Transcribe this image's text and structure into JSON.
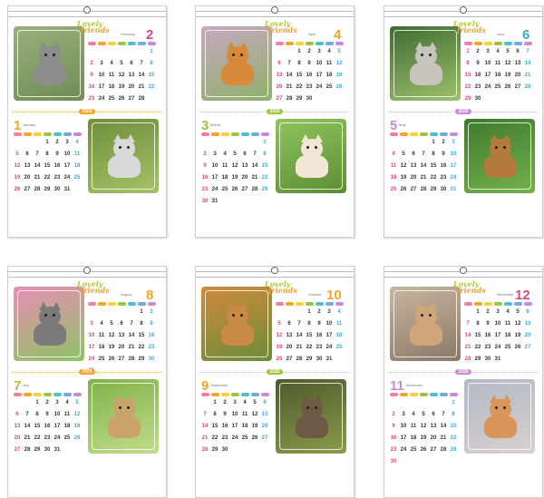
{
  "brand": {
    "line1": "Lovely",
    "line2": "friends"
  },
  "year_label": "2025",
  "colors": {
    "sunday": "#e0457b",
    "saturday": "#3aa9de",
    "weekday": "#333333",
    "year_pill_1": "#f6a623",
    "year_pill_2": "#9fc63b",
    "year_pill_3": "#c98ad6",
    "dow_pills": [
      "#f47fa5",
      "#f6a623",
      "#f7d239",
      "#9fc63b",
      "#4cc3c9",
      "#74a8e6",
      "#c98ad6"
    ]
  },
  "pages": [
    {
      "name": "page-jan-feb",
      "top": {
        "num": "2",
        "label": "February",
        "num_color": "#e0457b",
        "start": 6,
        "days": 28,
        "photo": "gray-tabby-kitten",
        "bg": [
          "#9bb07a",
          "#6f8c55"
        ]
      },
      "bottom": {
        "num": "1",
        "label": "January",
        "num_color": "#f6a623",
        "start": 3,
        "days": 31,
        "photo": "french-bulldog",
        "bg": [
          "#6e8e3c",
          "#a7c267"
        ]
      }
    },
    {
      "name": "page-mar-apr",
      "top": {
        "num": "4",
        "label": "April",
        "num_color": "#f6a623",
        "start": 2,
        "days": 30,
        "photo": "white-gray-kitten",
        "bg": [
          "#c7a8c0",
          "#8fb06a"
        ]
      },
      "bottom": {
        "num": "3",
        "label": "March",
        "num_color": "#9fc63b",
        "start": 6,
        "days": 31,
        "photo": "brown-toy-poodle",
        "bg": [
          "#8fc45d",
          "#5d8d34"
        ]
      }
    },
    {
      "name": "page-may-jun",
      "top": {
        "num": "6",
        "label": "June",
        "num_color": "#3aa9de",
        "start": 0,
        "days": 30,
        "photo": "orange-kitten",
        "bg": [
          "#3f6c33",
          "#9fc06c"
        ]
      },
      "bottom": {
        "num": "5",
        "label": "May",
        "num_color": "#c98ad6",
        "start": 4,
        "days": 31,
        "photo": "two-puppies",
        "bg": [
          "#3e7a2e",
          "#76b04c"
        ]
      }
    },
    {
      "name": "page-jul-aug",
      "top": {
        "num": "8",
        "label": "August",
        "num_color": "#f6a623",
        "start": 5,
        "days": 31,
        "photo": "two-kittens-flowers",
        "bg": [
          "#e88db4",
          "#8cc464"
        ]
      },
      "bottom": {
        "num": "7",
        "label": "July",
        "num_color": "#9fc63b",
        "start": 2,
        "days": 31,
        "photo": "chihuahua-puppy",
        "bg": [
          "#7fb24a",
          "#c3dc8b"
        ]
      }
    },
    {
      "name": "page-sep-oct",
      "top": {
        "num": "10",
        "label": "October",
        "num_color": "#f6a623",
        "start": 3,
        "days": 31,
        "photo": "gray-cat-grass",
        "bg": [
          "#d18a3c",
          "#6b8c3a"
        ]
      },
      "bottom": {
        "num": "9",
        "label": "September",
        "num_color": "#f6a623",
        "start": 1,
        "days": 30,
        "photo": "two-shiba-puppies",
        "bg": [
          "#4c5a2c",
          "#8b9c4a"
        ]
      }
    },
    {
      "name": "page-nov-dec",
      "top": {
        "num": "12",
        "label": "December",
        "num_color": "#e0457b",
        "start": 1,
        "days": 31,
        "photo": "two-fluffy-kittens",
        "bg": [
          "#c9b6a0",
          "#8a7868"
        ]
      },
      "bottom": {
        "num": "11",
        "label": "November",
        "num_color": "#c98ad6",
        "start": 6,
        "days": 30,
        "photo": "corgi-puppy",
        "bg": [
          "#b2b9c6",
          "#d9d0cf"
        ]
      }
    }
  ]
}
